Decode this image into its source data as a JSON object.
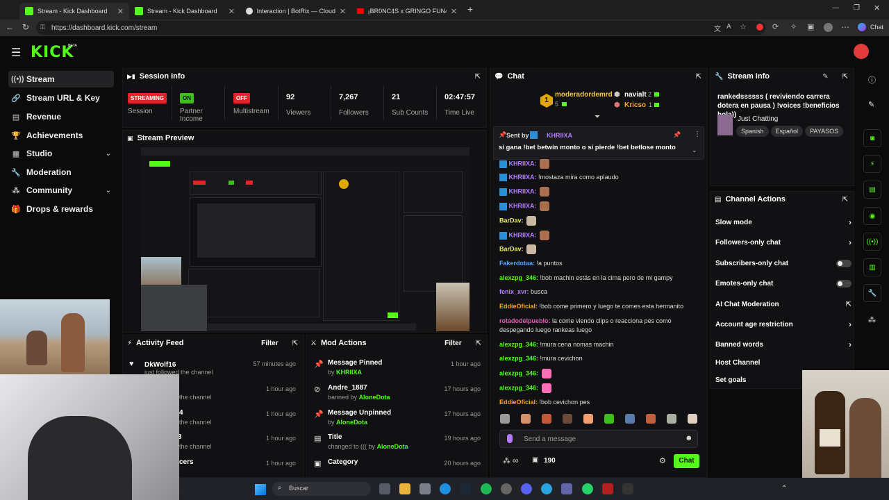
{
  "browser": {
    "tabs": [
      {
        "title": "Stream - Kick Dashboard",
        "active": true
      },
      {
        "title": "Stream - Kick Dashboard",
        "active": false
      },
      {
        "title": "Interaction | BotRix — Cloud Strea",
        "active": false
      },
      {
        "title": "¡BR0NC4S x GRINGO FUN4",
        "active": false
      }
    ],
    "url": "https://dashboard.kick.com/stream",
    "chat_button": "Chat"
  },
  "brand": {
    "logo": "KICK",
    "beta": "BETA"
  },
  "sidebar": {
    "items": [
      {
        "label": "Stream",
        "icon": "broadcast-icon"
      },
      {
        "label": "Stream URL & Key",
        "icon": "link-icon"
      },
      {
        "label": "Revenue",
        "icon": "revenue-icon"
      },
      {
        "label": "Achievements",
        "icon": "trophy-icon"
      },
      {
        "label": "Studio",
        "icon": "studio-icon"
      },
      {
        "label": "Moderation",
        "icon": "wrench-icon"
      },
      {
        "label": "Community",
        "icon": "community-icon"
      },
      {
        "label": "Drops & rewards",
        "icon": "gift-icon"
      }
    ]
  },
  "session": {
    "title": "Session Info",
    "stats": [
      {
        "badge": "STREAMING",
        "label": "Session",
        "color": "#e0252b"
      },
      {
        "badge": "ON",
        "label": "Partner Income",
        "color": "#3fbf1d"
      },
      {
        "badge": "OFF",
        "label": "Multistream",
        "color": "#e0252b"
      },
      {
        "value": "92",
        "label": "Viewers"
      },
      {
        "value": "7,267",
        "label": "Followers"
      },
      {
        "value": "21",
        "label": "Sub Counts"
      },
      {
        "value": "02:47:57",
        "label": "Time Live"
      }
    ]
  },
  "preview": {
    "title": "Stream Preview"
  },
  "activity": {
    "title": "Activity Feed",
    "filter": "Filter",
    "items": [
      {
        "title": "DkWolf16",
        "sub": "just followed the channel",
        "time": "57 minutes ago"
      },
      {
        "title": "",
        "sub": "the channel",
        "time": "1 hour ago"
      },
      {
        "title": "4",
        "sub": "the channel",
        "time": "1 hour ago"
      },
      {
        "title": "3",
        "sub": "the channel",
        "time": "1 hour ago"
      },
      {
        "title": "cers",
        "sub": "",
        "time": "1 hour ago"
      }
    ]
  },
  "mod_actions": {
    "title": "Mod Actions",
    "filter": "Filter",
    "items": [
      {
        "title": "Message Pinned",
        "prefix": "by",
        "user": "KHRIIXA",
        "time": "1 hour ago"
      },
      {
        "title": "Andre_1887",
        "prefix": "banned by",
        "user": "AloneDota",
        "time": "17 hours ago"
      },
      {
        "title": "Message Unpinned",
        "prefix": "by",
        "user": "AloneDota",
        "time": "17 hours ago"
      },
      {
        "title": "Title",
        "prefix": "changed to ((( by",
        "user": "AloneDota",
        "time": "19 hours ago"
      },
      {
        "title": "Category",
        "prefix": "",
        "user": "",
        "time": "20 hours ago"
      }
    ]
  },
  "chat": {
    "title": "Chat",
    "top": {
      "rank": "1",
      "user": "moderadordemrd",
      "count": "5",
      "second_user": "navialt",
      "second_count": "2",
      "third_user": "Kricso",
      "third_count": "1"
    },
    "pinned": {
      "label": "Sent by",
      "user": "KHRIIXA",
      "text": "si gana !bet betwin monto o si pierde !bet betlose monto"
    },
    "messages": [
      {
        "user": "KHRIIXA:",
        "text": "",
        "color": "#b57bff"
      },
      {
        "user": "KHRIIXA:",
        "text": "!mostaza mira como aplaudo",
        "color": "#b57bff"
      },
      {
        "user": "KHRIIXA:",
        "text": "",
        "color": "#b57bff"
      },
      {
        "user": "KHRIIXA:",
        "text": "",
        "color": "#b57bff"
      },
      {
        "user": "BarDav:",
        "text": "",
        "color": "#e8e86a"
      },
      {
        "user": "KHRIIXA:",
        "text": "",
        "color": "#b57bff"
      },
      {
        "user": "BarDav:",
        "text": "",
        "color": "#e8e86a"
      },
      {
        "user": "Fakerdotaa:",
        "text": "!a puntos",
        "color": "#5aa0ff"
      },
      {
        "user": "alexzpg_346:",
        "text": "!bob machin estás en la cima pero de mi gampy",
        "color": "#53fc18"
      },
      {
        "user": "fenix_xvr:",
        "text": "busca",
        "color": "#b57bff"
      },
      {
        "user": "EddieOficial:",
        "text": "!bob come primero y luego te comes esta hermanito",
        "color": "#f5a623"
      },
      {
        "user": "rotadodelpueblo:",
        "text": "la come viendo clips o reacciona pes como despegando luego rankeas luego",
        "color": "#e05fb3"
      },
      {
        "user": "alexzpg_346:",
        "text": "!mura cena nomas machin",
        "color": "#53fc18"
      },
      {
        "user": "alexzpg_346:",
        "text": "!mura cevichon",
        "color": "#53fc18"
      },
      {
        "user": "alexzpg_346:",
        "text": "",
        "color": "#53fc18"
      },
      {
        "user": "alexzpg_346:",
        "text": "",
        "color": "#53fc18"
      },
      {
        "user": "EddieOficial:",
        "text": "!bob cevichon pes",
        "color": "#f5a623"
      }
    ],
    "input_placeholder": "Send a message",
    "points": "190",
    "send": "Chat"
  },
  "stream_info": {
    "title": "Stream info",
    "stream_title": "rankedssssss ( reviviendo carrera dotera en pausa ) !voices !beneficios hola))",
    "category": "Just Chatting",
    "tags": [
      "Spanish",
      "Español",
      "PAYASOS"
    ]
  },
  "channel_actions": {
    "title": "Channel Actions",
    "items": [
      {
        "label": "Slow mode",
        "control": "arrow"
      },
      {
        "label": "Followers-only chat",
        "control": "arrow"
      },
      {
        "label": "Subscribers-only chat",
        "control": "toggle"
      },
      {
        "label": "Emotes-only chat",
        "control": "toggle"
      },
      {
        "label": "AI Chat Moderation",
        "control": "external"
      },
      {
        "label": "Account age restriction",
        "control": "arrow"
      },
      {
        "label": "Banned words",
        "control": "arrow"
      },
      {
        "label": "Host Channel",
        "control": "none"
      },
      {
        "label": "Set goals",
        "control": "none"
      }
    ]
  },
  "taskbar": {
    "search_placeholder": "Buscar"
  },
  "colors": {
    "accent": "#53fc18",
    "live": "#e0252b"
  }
}
